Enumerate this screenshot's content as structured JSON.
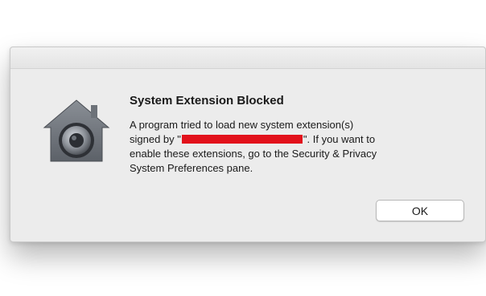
{
  "dialog": {
    "title": "System Extension Blocked",
    "message_line1": "A program tried to load new system extension(s)",
    "message_line2_prefix": "signed by \"",
    "message_line2_suffix": "\".  If you want to",
    "message_line3": "enable these extensions, go to the Security & Privacy",
    "message_line4": "System Preferences pane.",
    "ok_label": "OK",
    "icon": "security-lock-house-icon"
  },
  "colors": {
    "dialog_bg": "#ececec",
    "redaction": "#e2111b",
    "button_bg": "#ffffff"
  }
}
